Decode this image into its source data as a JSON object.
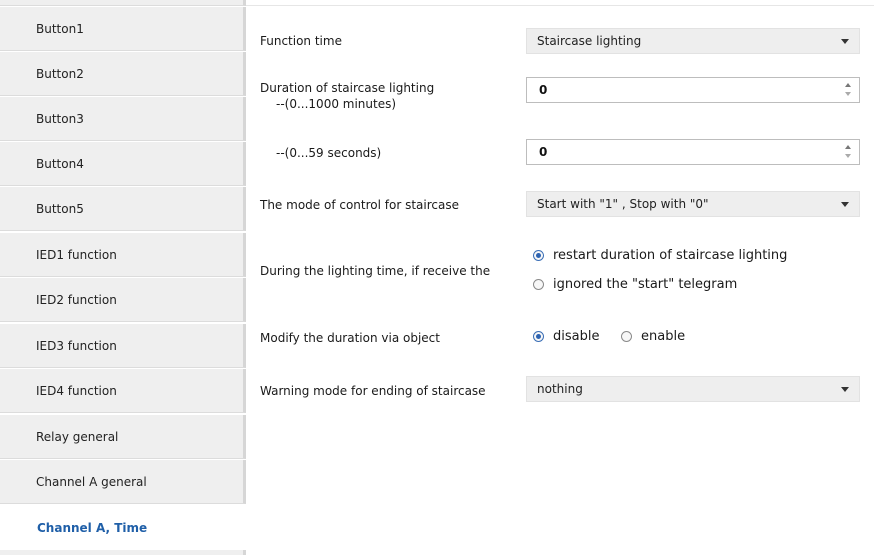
{
  "sidebar": {
    "items": [
      {
        "label": "Button1",
        "active": false
      },
      {
        "label": "Button2",
        "active": false
      },
      {
        "label": "Button3",
        "active": false
      },
      {
        "label": "Button4",
        "active": false
      },
      {
        "label": "Button5",
        "active": false
      },
      {
        "label": "IED1 function",
        "active": false
      },
      {
        "label": "IED2 function",
        "active": false
      },
      {
        "label": "IED3 function",
        "active": false
      },
      {
        "label": "IED4 function",
        "active": false
      },
      {
        "label": "Relay general",
        "active": false
      },
      {
        "label": "Channel A general",
        "active": false
      },
      {
        "label": "Channel A, Time",
        "active": true
      }
    ]
  },
  "params": {
    "function_time": {
      "label": "Function time",
      "value": "Staircase lighting"
    },
    "duration_minutes": {
      "label": "Duration of staircase lighting",
      "sublabel": "--(0...1000 minutes)",
      "value": "0"
    },
    "duration_seconds": {
      "label": "--(0...59 seconds)",
      "value": "0"
    },
    "control_mode": {
      "label": "The mode of control for staircase",
      "value": "Start with \"1\" , Stop with \"0\""
    },
    "receive_behavior": {
      "label": "During the lighting time, if receive the",
      "options": [
        "restart duration of staircase lighting",
        "ignored the \"start\" telegram"
      ],
      "selected": 0
    },
    "modify_duration": {
      "label": "Modify the duration via object",
      "options": [
        "disable",
        "enable"
      ],
      "selected": 0
    },
    "warning_mode": {
      "label": "Warning mode for ending of staircase",
      "value": "nothing"
    }
  },
  "colors": {
    "active_text": "#1f5fa8",
    "radio_accent": "#2d63b1",
    "sidebar_bg": "#efefef",
    "dropdown_bg": "#eeeeee"
  }
}
